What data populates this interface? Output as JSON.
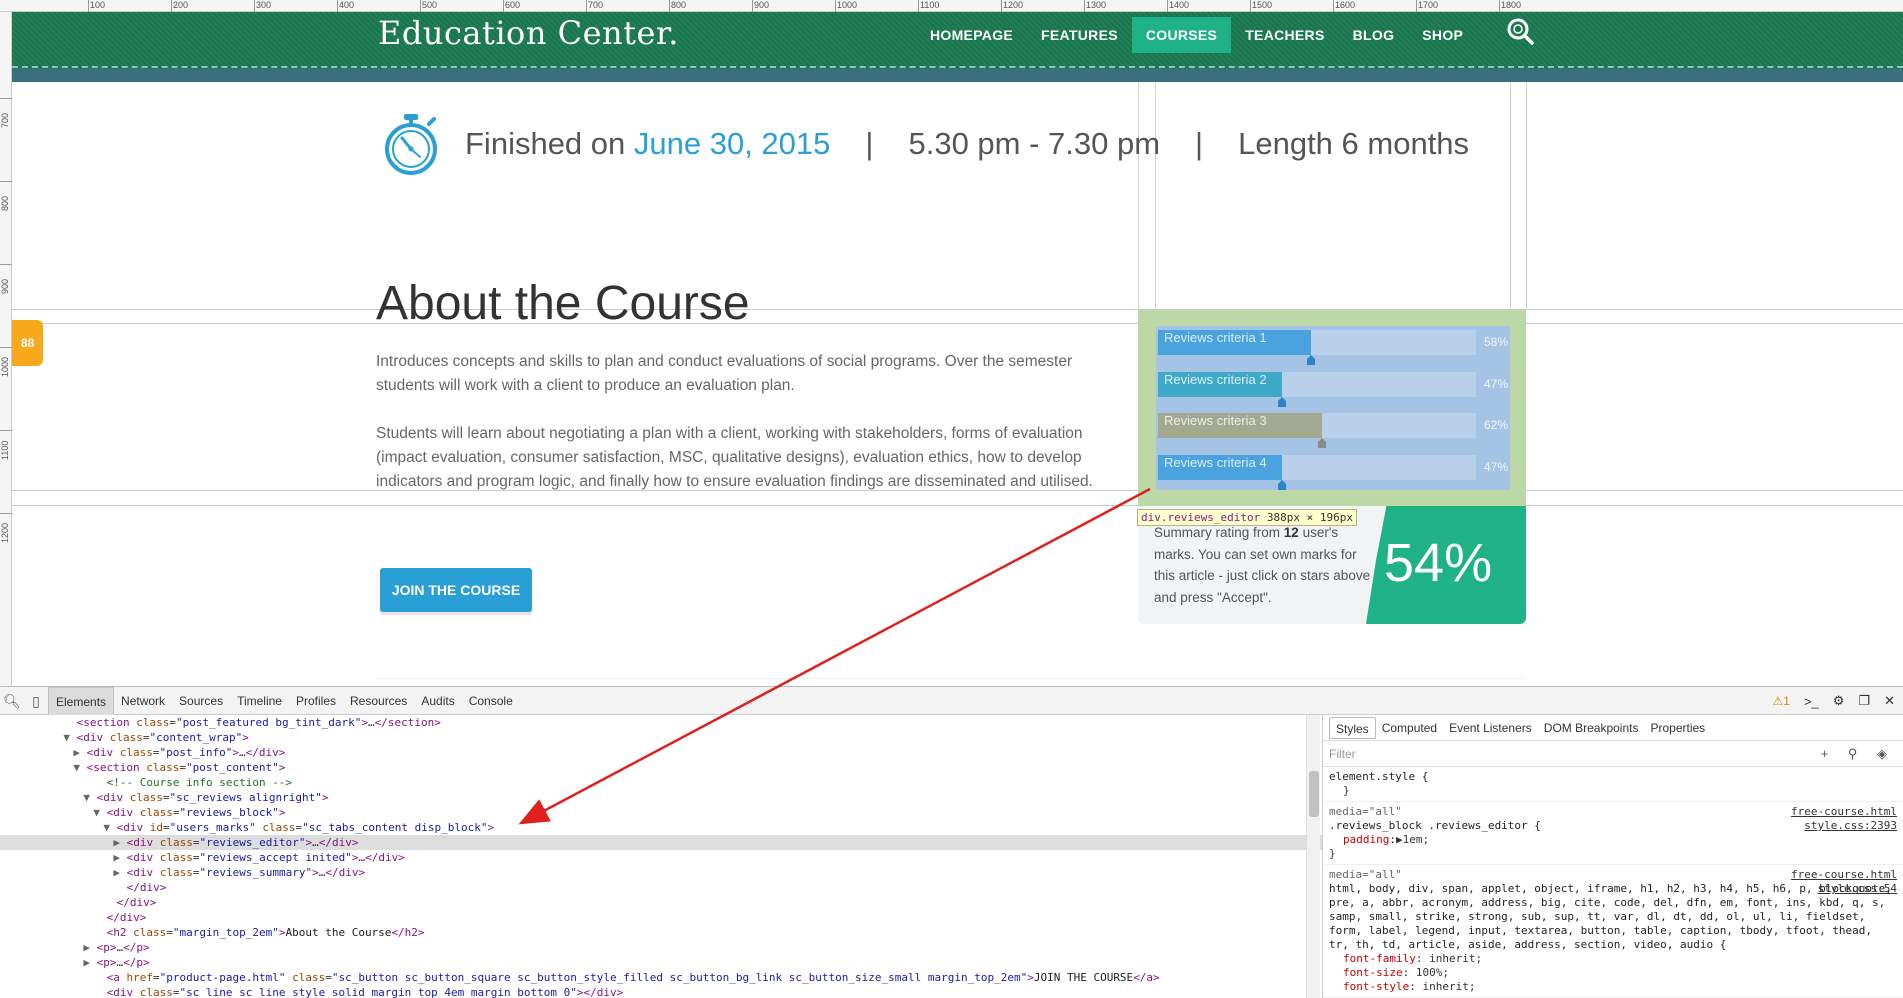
{
  "ruler": {
    "top_labels": [
      "100",
      "200",
      "300",
      "400",
      "500",
      "600",
      "700",
      "800",
      "900",
      "1000",
      "1100",
      "1200",
      "1300",
      "1400",
      "1500",
      "1600",
      "1700",
      "1800"
    ],
    "left_labels": [
      "700",
      "800",
      "900",
      "1000",
      "1100",
      "1200"
    ]
  },
  "header": {
    "logo": "Education Center.",
    "nav": [
      "HOMEPAGE",
      "FEATURES",
      "COURSES",
      "TEACHERS",
      "BLOG",
      "SHOP"
    ],
    "active_nav": "COURSES"
  },
  "course_info": {
    "finished_prefix": "Finished on ",
    "finished_date": "June 30, 2015",
    "separator": "|",
    "time": "5.30 pm - 7.30 pm",
    "length": "Length 6 months"
  },
  "about": {
    "title": "About the Course",
    "paragraph1": "Introduces concepts and skills to plan and conduct evaluations of social programs. Over the semester students will work with a client to produce an evaluation plan.",
    "paragraph2": "Students will learn about negotiating a plan with a client, working with stakeholders, forms of evaluation (impact evaluation, consumer satisfaction, MSC, qualitative designs), evaluation ethics, how to develop indicators and program logic, and finally how to ensure evaluation findings are disseminated and utilised.",
    "button": "JOIN THE COURSE"
  },
  "side_tab": "88",
  "reviews": {
    "criteria": [
      {
        "label": "Reviews criteria 1",
        "percent": 58,
        "pct_text": "58%",
        "color": "#4aa3df"
      },
      {
        "label": "Reviews criteria 2",
        "percent": 47,
        "pct_text": "47%",
        "color": "#3fa9c9"
      },
      {
        "label": "Reviews criteria 3",
        "percent": 62,
        "pct_text": "62%",
        "color": "#a3a890"
      },
      {
        "label": "Reviews criteria 4",
        "percent": 47,
        "pct_text": "47%",
        "color": "#4aa3df"
      }
    ],
    "tooltip_class": "div.reviews_editor",
    "tooltip_size": "388px × 196px",
    "summary_pre": "Summary rating from ",
    "summary_count": "12",
    "summary_post": " user's marks. You can set own marks for this article - just click on stars above and press \"Accept\".",
    "score": "54%"
  },
  "devtools": {
    "tabs": [
      "Elements",
      "Network",
      "Sources",
      "Timeline",
      "Profiles",
      "Resources",
      "Audits",
      "Console"
    ],
    "active_tab": "Elements",
    "warning_count": "1",
    "dom_lines": [
      {
        "indent": 7,
        "html": "<span class='t'>&lt;section</span> <span class='a'>class</span>=<span class='v'>\"post_featured bg_tint_dark\"</span><span class='t'>&gt;</span>…<span class='t'>&lt;/section&gt;</span>"
      },
      {
        "indent": 7,
        "arrow": "▼",
        "html": "<span class='t'>&lt;div</span> <span class='a'>class</span>=<span class='v'>\"content_wrap\"</span><span class='t'>&gt;</span>"
      },
      {
        "indent": 8,
        "arrow": "▶",
        "html": "<span class='t'>&lt;div</span> <span class='a'>class</span>=<span class='v'>\"post_info\"</span><span class='t'>&gt;</span>…<span class='t'>&lt;/div&gt;</span>"
      },
      {
        "indent": 8,
        "arrow": "▼",
        "html": "<span class='t'>&lt;section</span> <span class='a'>class</span>=<span class='v'>\"post_content\"</span><span class='t'>&gt;</span>"
      },
      {
        "indent": 10,
        "html": "<span class='c'>&lt;!-- Course info section --&gt;</span>"
      },
      {
        "indent": 9,
        "arrow": "▼",
        "html": "<span class='t'>&lt;div</span> <span class='a'>class</span>=<span class='v'>\"sc_reviews alignright\"</span><span class='t'>&gt;</span>"
      },
      {
        "indent": 10,
        "arrow": "▼",
        "html": "<span class='t'>&lt;div</span> <span class='a'>class</span>=<span class='v'>\"reviews_block\"</span><span class='t'>&gt;</span>"
      },
      {
        "indent": 11,
        "arrow": "▼",
        "html": "<span class='t'>&lt;div</span> <span class='a'>id</span>=<span class='v'>\"users_marks\"</span> <span class='a'>class</span>=<span class='v'>\"sc_tabs_content disp_block\"</span><span class='t'>&gt;</span>"
      },
      {
        "indent": 12,
        "arrow": "▶",
        "selected": true,
        "html": "<span class='t'>&lt;div</span> <span class='a'>class</span>=<span class='v'>\"reviews_editor\"</span><span class='t'>&gt;</span>…<span class='t'>&lt;/div&gt;</span>"
      },
      {
        "indent": 12,
        "arrow": "▶",
        "html": "<span class='t'>&lt;div</span> <span class='a'>class</span>=<span class='v'>\"reviews_accept inited\"</span><span class='t'>&gt;</span>…<span class='t'>&lt;/div&gt;</span>"
      },
      {
        "indent": 12,
        "arrow": "▶",
        "html": "<span class='t'>&lt;div</span> <span class='a'>class</span>=<span class='v'>\"reviews_summary\"</span><span class='t'>&gt;</span>…<span class='t'>&lt;/div&gt;</span>"
      },
      {
        "indent": 12,
        "html": "<span class='t'>&lt;/div&gt;</span>"
      },
      {
        "indent": 11,
        "html": "<span class='t'>&lt;/div&gt;</span>"
      },
      {
        "indent": 10,
        "html": "<span class='t'>&lt;/div&gt;</span>"
      },
      {
        "indent": 10,
        "html": "<span class='t'>&lt;h2</span> <span class='a'>class</span>=<span class='v'>\"margin_top_2em\"</span><span class='t'>&gt;</span><span class='tx'>About the Course</span><span class='t'>&lt;/h2&gt;</span>"
      },
      {
        "indent": 9,
        "arrow": "▶",
        "html": "<span class='t'>&lt;p&gt;</span>…<span class='t'>&lt;/p&gt;</span>"
      },
      {
        "indent": 9,
        "arrow": "▶",
        "html": "<span class='t'>&lt;p&gt;</span>…<span class='t'>&lt;/p&gt;</span>"
      },
      {
        "indent": 10,
        "html": "<span class='t'>&lt;a</span> <span class='a'>href</span>=<span class='v'>\"product-page.html\"</span> <span class='a'>class</span>=<span class='v'>\"sc_button sc_button_square sc_button_style_filled sc_button_bg_link sc_button_size_small margin_top_2em\"</span><span class='t'>&gt;</span><span class='tx'>JOIN THE COURSE</span><span class='t'>&lt;/a&gt;</span>"
      },
      {
        "indent": 10,
        "html": "<span class='t'>&lt;div</span> <span class='a'>class</span>=<span class='v'>\"sc_line sc_line_style_solid margin_top_4em margin_bottom_0\"</span><span class='t'>&gt;</span><span class='t'>&lt;/div&gt;</span>"
      }
    ],
    "styles_tabs": [
      "Styles",
      "Computed",
      "Event Listeners",
      "DOM Breakpoints",
      "Properties"
    ],
    "active_styles_tab": "Styles",
    "filter_placeholder": "Filter",
    "rules": [
      {
        "media": "",
        "selector": "element.style {",
        "src": "",
        "body": "}"
      },
      {
        "media": "media=\"all\"",
        "selector": ".reviews_block .reviews_editor {",
        "src": "free-course.html",
        "src2": "style.css:2393",
        "body": "<span class='prop'>padding</span>:▶1em;",
        "close": "}"
      },
      {
        "media": "media=\"all\"",
        "selector": "html, body, div, span, applet, object, iframe, h1, h2, h3, h4, h5, h6, p, blockquote, pre, a, abbr, acronym, address, big, cite, code, del, dfn, em, font, ins, kbd, q, s, samp, small, strike, strong, sub, sup, tt, var, dl, dt, dd, ol, ul, li, fieldset, form, label, legend, input, textarea, button, table, caption, tbody, tfoot, thead, tr, th, td, article, aside, address, section, video, audio {",
        "src": "free-course.html",
        "src2": "style.css:54",
        "body": "<span class='prop'>font-family</span>: inherit;<br><span class='prop'>font-size</span>: 100%;<br><span class='prop'>font-style</span>: inherit;"
      }
    ]
  }
}
